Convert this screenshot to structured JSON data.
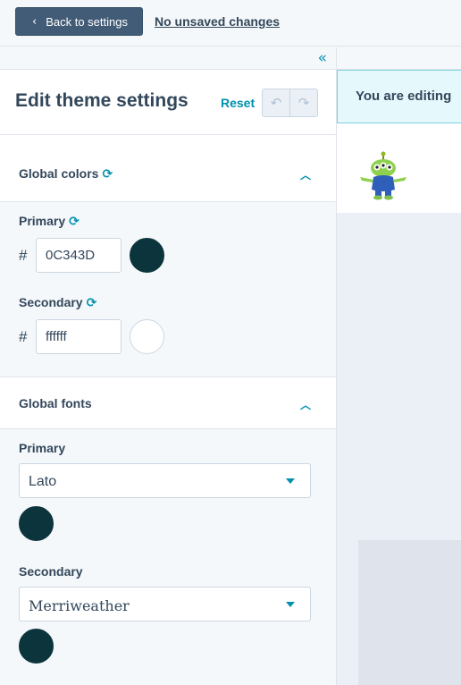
{
  "topbar": {
    "back_label": "Back to settings",
    "unsaved_label": "No unsaved changes"
  },
  "header": {
    "title": "Edit theme settings",
    "reset_label": "Reset"
  },
  "global_colors": {
    "title": "Global colors",
    "primary": {
      "label": "Primary",
      "hex": "0C343D",
      "color": "#0C343D"
    },
    "secondary": {
      "label": "Secondary",
      "hex": "ffffff",
      "color": "#ffffff"
    },
    "hash": "#"
  },
  "global_fonts": {
    "title": "Global fonts",
    "primary": {
      "label": "Primary",
      "font": "Lato",
      "color": "#0C343D"
    },
    "secondary": {
      "label": "Secondary",
      "font": "Merriweather",
      "color": "#0C343D"
    }
  },
  "preview": {
    "banner_text": "You are editing"
  },
  "icons": [
    "chevron-left-icon",
    "double-chevron-left-icon",
    "undo-icon",
    "redo-icon",
    "sync-icon",
    "chevron-up-icon",
    "caret-down-icon"
  ]
}
